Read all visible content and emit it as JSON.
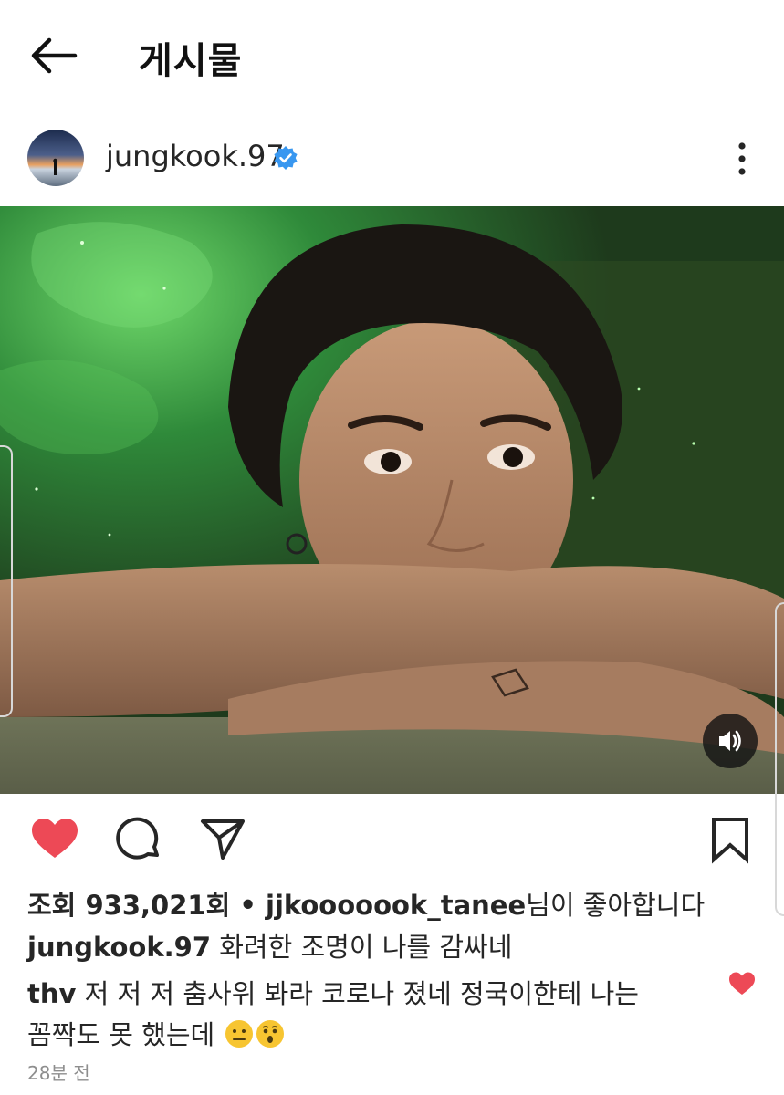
{
  "header": {
    "title": "게시물",
    "back_icon": "arrow-left-icon"
  },
  "post": {
    "username": "jungkook.97",
    "verified_icon": "verified-badge-icon",
    "more_icon": "more-vertical-icon",
    "sound_icon": "speaker-icon",
    "image_caption": "video-thumbnail",
    "accent_color": "#3897f0",
    "like_color": "#ed4956"
  },
  "actions": {
    "like_icon": "heart-filled-icon",
    "comment_icon": "comment-icon",
    "share_icon": "send-icon",
    "save_icon": "bookmark-icon"
  },
  "stats": {
    "views_label": "조회",
    "views_count": "933,021회",
    "separator": " • ",
    "liker": "jjkooooook_tanee",
    "liked_text": "님이 좋아합니다"
  },
  "caption": {
    "username": "jungkook.97",
    "text": " 화려한 조명이 나를 감싸네"
  },
  "comment": {
    "username": "thv",
    "line1": " 저 저 저 춤사위 봐라 코로나 졌네 정국이한테 나는",
    "line2": "꼼짝도 못 했는데"
  },
  "timestamp": "28분 전"
}
